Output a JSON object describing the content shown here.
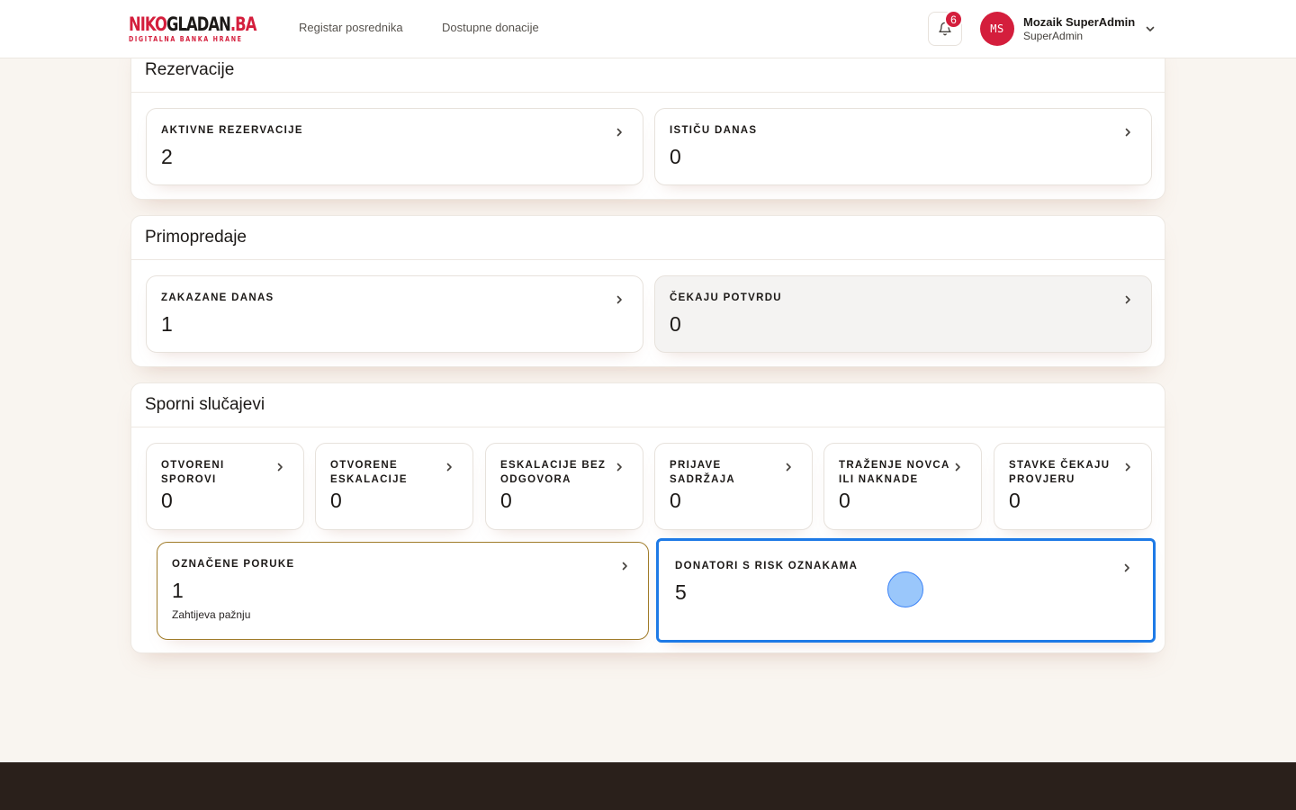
{
  "header": {
    "logo_main_red": "NIKO",
    "logo_main_dark": "GLADAN",
    "logo_main_suffix": ".BA",
    "logo_tagline": "DIGITALNA BANKA HRANE",
    "nav": [
      "Registar posrednika",
      "Dostupne donacije"
    ],
    "notifications_count": "6",
    "user": {
      "initials": "MS",
      "name": "Mozaik SuperAdmin",
      "role": "SuperAdmin"
    }
  },
  "sections": {
    "rezervacije": {
      "title": "Rezervacije",
      "cards": [
        {
          "label": "AKTIVNE REZERVACIJE",
          "value": "2"
        },
        {
          "label": "ISTIČU DANAS",
          "value": "0"
        }
      ]
    },
    "primopredaje": {
      "title": "Primopredaje",
      "cards": [
        {
          "label": "ZAKAZANE DANAS",
          "value": "1"
        },
        {
          "label": "ČEKAJU POTVRDU",
          "value": "0"
        }
      ]
    },
    "sporni": {
      "title": "Sporni slučajevi",
      "cards": [
        {
          "label_line1": "OTVORENI",
          "label_line2": "SPOROVI",
          "value": "0"
        },
        {
          "label_line1": "OTVORENE",
          "label_line2": "ESKALACIJE",
          "value": "0"
        },
        {
          "label_line1": "ESKALACIJE BEZ",
          "label_line2": "ODGOVORA",
          "value": "0"
        },
        {
          "label_line1": "PRIJAVE",
          "label_line2": "SADRŽAJA",
          "value": "0"
        },
        {
          "label_line1": "TRAŽENJE NOVCA",
          "label_line2": "ILI NAKNADE",
          "value": "0"
        },
        {
          "label_line1": "STAVKE ČEKAJU",
          "label_line2": "PROVJERU",
          "value": "0"
        }
      ],
      "wide_cards": [
        {
          "label": "OZNAČENE PORUKE",
          "value": "1",
          "note": "Zahtijeva pažnju"
        },
        {
          "label": "DONATORI S RISK OZNAKAMA",
          "value": "5"
        }
      ]
    }
  },
  "colors": {
    "brand_red": "#d41e3c",
    "page_bg": "#f9f5f0",
    "focus_blue": "#1e7ae6",
    "warning_border": "#a07c2a",
    "footer_bg": "#2a201b"
  },
  "icons": [
    "bell-icon",
    "chevron-down-icon",
    "chevron-right-icon"
  ]
}
